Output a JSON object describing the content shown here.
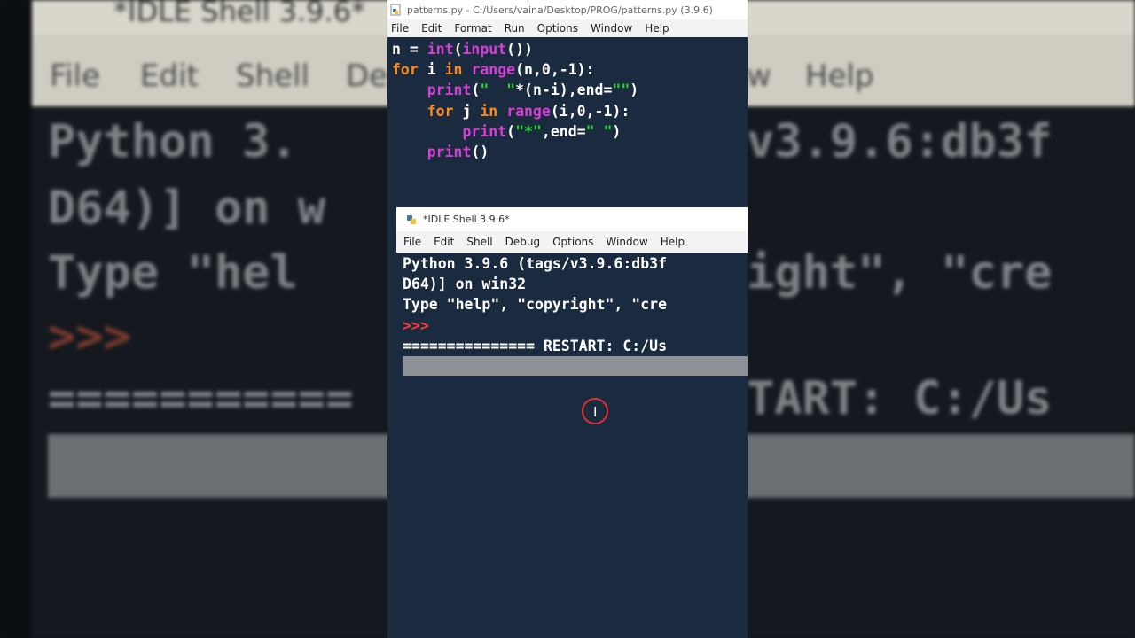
{
  "background": {
    "title": "*IDLE Shell 3.9.6*",
    "menu": [
      "File",
      "Edit",
      "Shell",
      "De",
      "w",
      "Help"
    ],
    "lines": [
      "Python 3.",
      "v3.9.6:db3f",
      "D64)] on w",
      "Type \"hel",
      "ight\", \"cre",
      "===========",
      "TART: C:/Us"
    ],
    "prompt": ">>>"
  },
  "editor": {
    "title": "patterns.py - C:/Users/vaina/Desktop/PROG/patterns.py (3.9.6)",
    "menu": [
      "File",
      "Edit",
      "Format",
      "Run",
      "Options",
      "Window",
      "Help"
    ]
  },
  "shell": {
    "title": "*IDLE Shell 3.9.6*",
    "menu": [
      "File",
      "Edit",
      "Shell",
      "Debug",
      "Options",
      "Window",
      "Help"
    ],
    "lines": [
      "Python 3.9.6 (tags/v3.9.6:db3f",
      "D64)] on win32",
      "Type \"help\", \"copyright\", \"cre"
    ],
    "prompt": ">>>",
    "restart": "=============== RESTART: C:/Us"
  },
  "colors": {
    "keyword": "#ff8a1a",
    "builtin": "#d63fd6",
    "string": "#22dd22",
    "prompt": "#ff3b3b",
    "background": "#1a2b3f"
  }
}
